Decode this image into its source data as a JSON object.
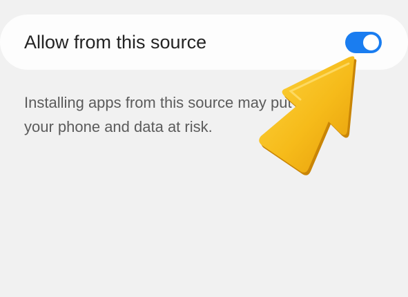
{
  "setting": {
    "label": "Allow from this source",
    "toggle_state": "on",
    "accent_color": "#1a7df0"
  },
  "description": {
    "text": "Installing apps from this source may put your phone and data at risk."
  },
  "overlay": {
    "icon": "pointer-arrow-icon",
    "color": "#f5b614"
  }
}
